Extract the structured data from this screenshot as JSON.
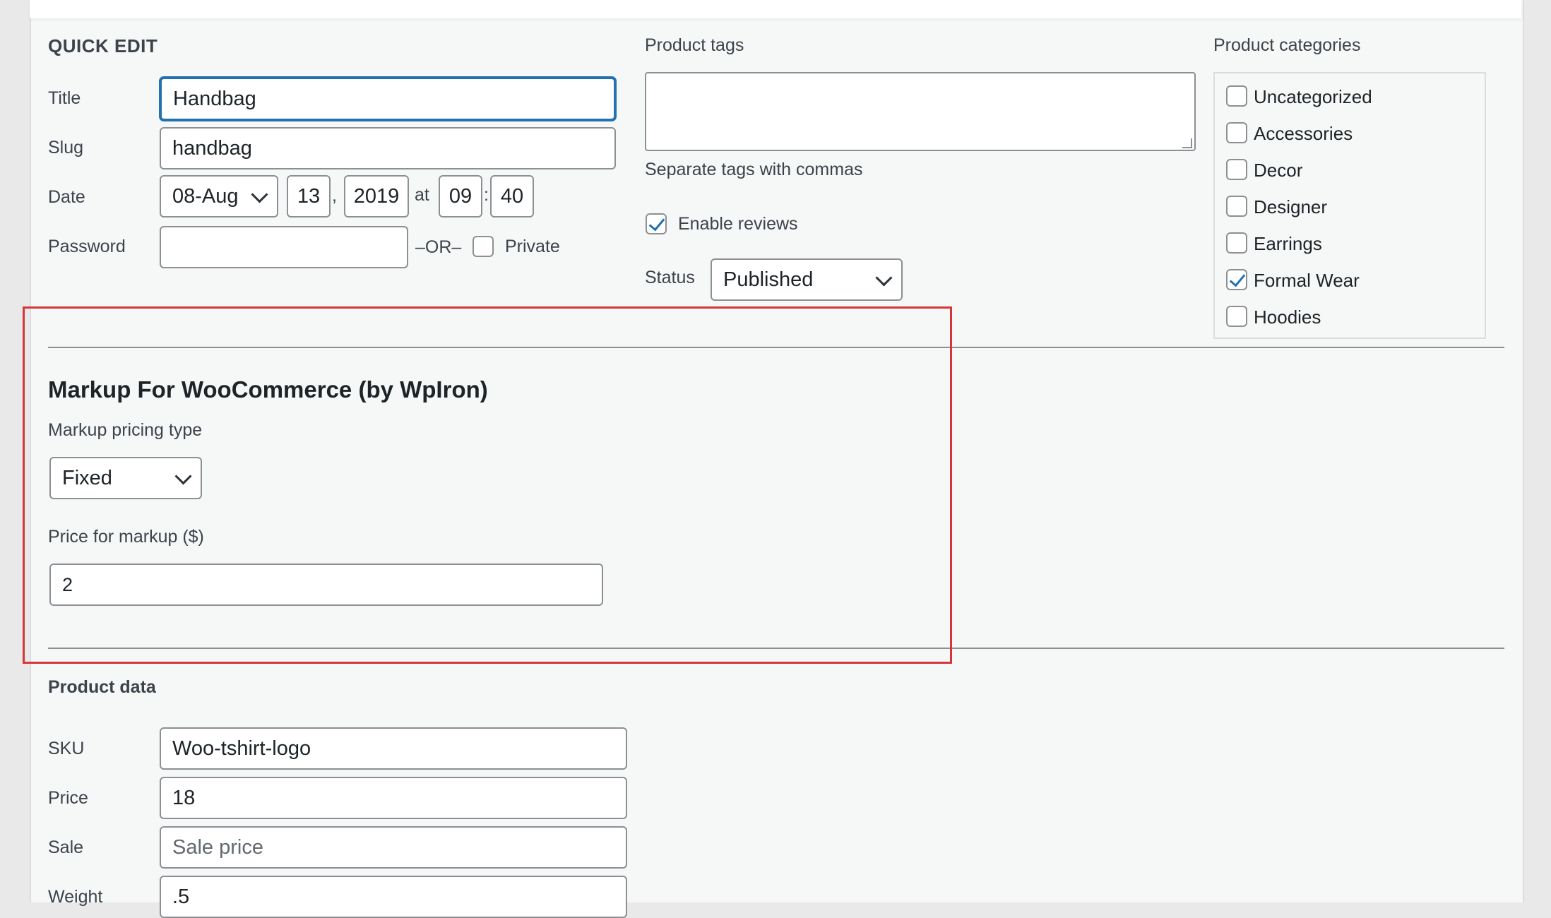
{
  "quick_edit": {
    "heading": "QUICK EDIT",
    "title_label": "Title",
    "title_value": "Handbag",
    "slug_label": "Slug",
    "slug_value": "handbag",
    "date_label": "Date",
    "date_month": "08-Aug",
    "date_day": "13",
    "date_comma": ",",
    "date_year": "2019",
    "date_at": "at",
    "date_hour": "09",
    "date_colon": ":",
    "date_minute": "40",
    "password_label": "Password",
    "password_value": "",
    "or_label": "–OR–",
    "private_label": "Private"
  },
  "tags": {
    "label": "Product tags",
    "value": "",
    "hint": "Separate tags with commas",
    "enable_reviews_label": "Enable reviews",
    "status_label": "Status",
    "status_value": "Published"
  },
  "categories": {
    "label": "Product categories",
    "items": [
      {
        "label": "Uncategorized",
        "checked": false
      },
      {
        "label": "Accessories",
        "checked": false
      },
      {
        "label": "Decor",
        "checked": false
      },
      {
        "label": "Designer",
        "checked": false
      },
      {
        "label": "Earrings",
        "checked": false
      },
      {
        "label": "Formal Wear",
        "checked": true
      },
      {
        "label": "Hoodies",
        "checked": false
      }
    ]
  },
  "markup": {
    "heading": "Markup For WooCommerce (by WpIron)",
    "pricing_type_label": "Markup pricing type",
    "pricing_type_value": "Fixed",
    "price_label": "Price for markup ($)",
    "price_value": "2",
    "highlight_color": "#d63638"
  },
  "product_data": {
    "heading": "Product data",
    "sku_label": "SKU",
    "sku_value": "Woo-tshirt-logo",
    "price_label": "Price",
    "price_value": "18",
    "sale_label": "Sale",
    "sale_placeholder": "Sale price",
    "weight_label": "Weight",
    "weight_value": ".5"
  }
}
